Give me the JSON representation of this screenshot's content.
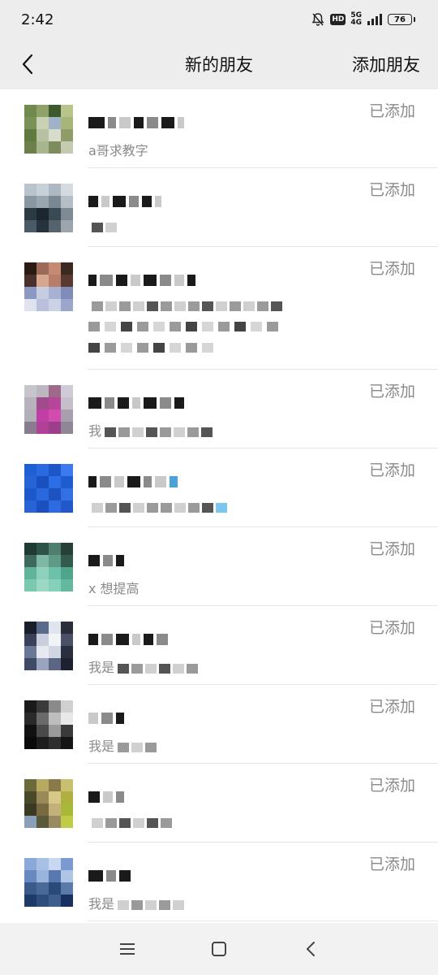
{
  "status_bar": {
    "time": "2:42",
    "hd": "HD",
    "network_top": "5G",
    "network_bottom": "4G",
    "battery": "76"
  },
  "nav": {
    "title": "新的朋友",
    "action": "添加朋友"
  },
  "requests": [
    {
      "message": "a哥求教字",
      "status": "已添加"
    },
    {
      "message": "",
      "status": "已添加"
    },
    {
      "message": "",
      "status": "已添加"
    },
    {
      "message": "我",
      "status": "已添加"
    },
    {
      "message": "",
      "status": "已添加"
    },
    {
      "message": "x 想提高",
      "status": "已添加"
    },
    {
      "message": "我是",
      "status": "已添加"
    },
    {
      "message": "我是",
      "status": "已添加"
    },
    {
      "message": "",
      "status": "已添加"
    },
    {
      "message": "我是",
      "status": "已添加"
    }
  ],
  "colors": {
    "background": "#ededed",
    "list_bg": "#ffffff",
    "secondary_text": "#8a8a8a"
  }
}
